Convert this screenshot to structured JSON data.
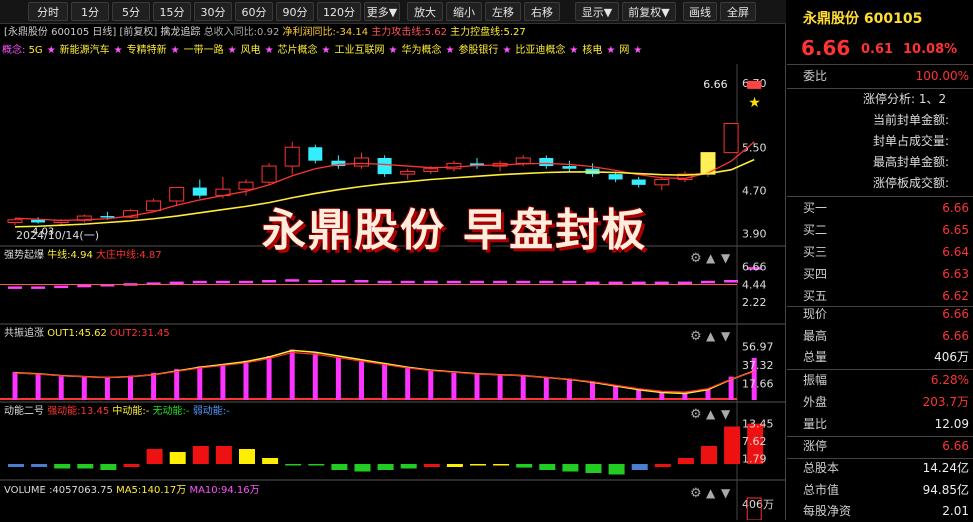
{
  "toolbar": {
    "buttons": [
      "分时",
      "1分",
      "5分",
      "15分",
      "30分",
      "60分",
      "90分",
      "120分",
      "更多▼",
      "放大",
      "缩小",
      "左移",
      "右移",
      "显示▼",
      "前复权▼",
      "画线",
      "全屏"
    ]
  },
  "chart": {
    "header": "[永鼎股份 600105 日线] [前复权] ",
    "indicator_name": "擒龙追踪",
    "fields": [
      "总收入同比:0.92",
      "净利润同比:-34.14",
      "主力攻击线:5.62",
      "主力控盘线:5.27"
    ],
    "concept_label": "概念:",
    "concepts": [
      "5G",
      "新能源汽车",
      "专精特新",
      "一带一路",
      "风电",
      "芯片概念",
      "工业互联网",
      "华为概念",
      "参股银行",
      "比亚迪概念",
      "核电",
      "网"
    ],
    "date_label": "2024/10/14(一)",
    "price_ticks": [
      "6.70",
      "5.50",
      "4.70",
      "3.90"
    ],
    "high_label": "6.66",
    "low_label": "4.03",
    "banner": "永鼎股份 早盘封板"
  },
  "panel1": {
    "name": "强势起爆",
    "f1": "牛线:4.94",
    "f2": "大庄中线:4.87",
    "ticks": [
      "6.66",
      "4.44",
      "2.22"
    ]
  },
  "panel2": {
    "name": "共振追涨",
    "f1": "OUT1:45.62",
    "f2": "OUT2:31.45",
    "ticks": [
      "56.97",
      "37.32",
      "17.66"
    ]
  },
  "panel3": {
    "name": "动能二号",
    "f1": "强动能:13.45",
    "f2": "中动能:-",
    "f3": "无动能:-",
    "f4": "弱动能:-",
    "ticks": [
      "13.45",
      "7.62",
      "1.79"
    ]
  },
  "panel4": {
    "name": "VOLUME",
    "f1": ":4057063.75",
    "f2": "MA5:140.17万",
    "f3": "MA10:94.16万",
    "ticks": [
      "406万"
    ]
  },
  "info": {
    "title": "永鼎股份 600105",
    "price": "6.66",
    "change": "0.61",
    "pct": "10.08%",
    "weibi_label": "委比",
    "weibi": "100.00%",
    "zt_analysis": "涨停分析: 1、2",
    "zt_lines": [
      "当前封单金额:",
      "封单占成交量:",
      "最高封单金额:",
      "涨停板成交额:"
    ],
    "sells": [
      {
        "l": "买一",
        "v": "6.66"
      },
      {
        "l": "买二",
        "v": "6.65"
      },
      {
        "l": "买三",
        "v": "6.64"
      },
      {
        "l": "买四",
        "v": "6.63"
      },
      {
        "l": "买五",
        "v": "6.62"
      }
    ],
    "stats": [
      {
        "l": "现价",
        "v": "6.66",
        "c": "red"
      },
      {
        "l": "最高",
        "v": "6.66",
        "c": "red"
      },
      {
        "l": "总量",
        "v": "406万",
        "c": "white"
      },
      {
        "l": "振幅",
        "v": "6.28%",
        "c": "red"
      },
      {
        "l": "外盘",
        "v": "203.7万",
        "c": "red"
      },
      {
        "l": "量比",
        "v": "12.09",
        "c": "white"
      },
      {
        "l": "涨停",
        "v": "6.66",
        "c": "red"
      },
      {
        "l": "总股本",
        "v": "14.24亿",
        "c": "white"
      },
      {
        "l": "总市值",
        "v": "94.85亿",
        "c": "white"
      },
      {
        "l": "每股净资",
        "v": "2.01",
        "c": "white"
      }
    ]
  },
  "chart_data": {
    "type": "candlestick",
    "ohlc": [
      [
        4.1,
        4.18,
        4.05,
        4.15
      ],
      [
        4.15,
        4.2,
        4.08,
        4.1
      ],
      [
        4.1,
        4.16,
        4.03,
        4.14
      ],
      [
        4.14,
        4.25,
        4.1,
        4.22
      ],
      [
        4.22,
        4.3,
        4.15,
        4.2
      ],
      [
        4.2,
        4.35,
        4.18,
        4.32
      ],
      [
        4.32,
        4.55,
        4.3,
        4.5
      ],
      [
        4.5,
        4.7,
        4.4,
        4.75
      ],
      [
        4.75,
        4.9,
        4.55,
        4.6
      ],
      [
        4.6,
        4.95,
        4.55,
        4.72
      ],
      [
        4.72,
        4.9,
        4.6,
        4.85
      ],
      [
        4.85,
        5.2,
        4.8,
        5.15
      ],
      [
        5.15,
        5.6,
        5.0,
        5.5
      ],
      [
        5.5,
        5.55,
        5.2,
        5.25
      ],
      [
        5.25,
        5.35,
        5.1,
        5.15
      ],
      [
        5.15,
        5.4,
        5.1,
        5.3
      ],
      [
        5.3,
        5.35,
        4.95,
        5.0
      ],
      [
        5.0,
        5.1,
        4.9,
        5.05
      ],
      [
        5.05,
        5.15,
        5.0,
        5.1
      ],
      [
        5.1,
        5.25,
        5.05,
        5.2
      ],
      [
        5.2,
        5.3,
        5.1,
        5.15
      ],
      [
        5.15,
        5.25,
        5.05,
        5.2
      ],
      [
        5.2,
        5.35,
        5.15,
        5.3
      ],
      [
        5.3,
        5.35,
        5.1,
        5.15
      ],
      [
        5.15,
        5.25,
        5.05,
        5.1
      ],
      [
        5.1,
        5.2,
        4.95,
        5.0
      ],
      [
        5.0,
        5.05,
        4.85,
        4.9
      ],
      [
        4.9,
        4.95,
        4.75,
        4.8
      ],
      [
        4.8,
        4.95,
        4.7,
        4.9
      ],
      [
        4.9,
        5.05,
        4.85,
        5.0
      ],
      [
        5.0,
        5.4,
        4.95,
        5.4
      ],
      [
        5.4,
        5.95,
        5.4,
        5.94
      ],
      [
        6.66,
        6.66,
        6.66,
        6.66
      ]
    ],
    "ma_short": [
      4.18,
      4.16,
      4.14,
      4.15,
      4.17,
      4.22,
      4.3,
      4.42,
      4.52,
      4.6,
      4.68,
      4.8,
      4.97,
      5.1,
      5.18,
      5.2,
      5.18,
      5.15,
      5.12,
      5.13,
      5.16,
      5.17,
      5.19,
      5.2,
      5.18,
      5.14,
      5.07,
      4.99,
      4.93,
      4.92,
      5.02,
      5.24,
      5.6
    ],
    "ma_long": [
      4.02,
      4.03,
      4.05,
      4.07,
      4.1,
      4.13,
      4.17,
      4.22,
      4.28,
      4.34,
      4.4,
      4.47,
      4.56,
      4.64,
      4.71,
      4.77,
      4.82,
      4.86,
      4.9,
      4.93,
      4.96,
      4.99,
      5.01,
      5.03,
      5.04,
      5.04,
      5.03,
      5.01,
      4.99,
      4.98,
      5.01,
      5.08,
      5.27
    ],
    "y_range": [
      3.7,
      6.9
    ],
    "p1_values": [
      4.2,
      4.2,
      4.3,
      4.4,
      4.5,
      4.6,
      4.7,
      4.8,
      4.9,
      4.9,
      4.9,
      5.0,
      5.1,
      5.0,
      5.0,
      5.0,
      4.9,
      4.9,
      4.9,
      4.9,
      4.9,
      4.9,
      4.9,
      4.9,
      4.9,
      4.8,
      4.8,
      4.8,
      4.8,
      4.8,
      4.9,
      5.0,
      6.6
    ],
    "p2_values": [
      30,
      28,
      25,
      24,
      24,
      26,
      29,
      33,
      36,
      38,
      42,
      47,
      54,
      50,
      45,
      42,
      38,
      34,
      31,
      29,
      28,
      27,
      26,
      24,
      23,
      20,
      16,
      12,
      8,
      8,
      12,
      25,
      45
    ],
    "p2_line": [
      29,
      28,
      26,
      25,
      24,
      25,
      27,
      31,
      35,
      38,
      41,
      46,
      53,
      51,
      47,
      43,
      39,
      35,
      32,
      30,
      28,
      27,
      26,
      24,
      22,
      19,
      15,
      11,
      8,
      7,
      11,
      22,
      31
    ],
    "p3_values": [
      -1,
      -1,
      -1.5,
      -1.5,
      -2,
      -1,
      5,
      4,
      6,
      6,
      5,
      2,
      0,
      -0.5,
      -2,
      -2.5,
      -2,
      -1.5,
      -1,
      -1,
      -0.5,
      -0.5,
      -1.2,
      -2,
      -2.5,
      -3,
      -3.5,
      -2,
      -1,
      2,
      6,
      12.5,
      13.45
    ],
    "p3_colors": [
      "#4a7fd0",
      "#4a7fd0",
      "#22cc22",
      "#22cc22",
      "#22cc22",
      "#ee1111",
      "#ee1111",
      "#ffee00",
      "#ee1111",
      "#ee1111",
      "#ffee00",
      "#ffee00",
      "#22cc22",
      "#22cc22",
      "#22cc22",
      "#22cc22",
      "#22cc22",
      "#22cc22",
      "#ee1111",
      "#ffee00",
      "#ffee00",
      "#ffee00",
      "#22cc22",
      "#22cc22",
      "#22cc22",
      "#22cc22",
      "#22cc22",
      "#4a7fd0",
      "#ee1111",
      "#ee1111",
      "#ee1111",
      "#ee1111",
      "#ee1111"
    ]
  }
}
